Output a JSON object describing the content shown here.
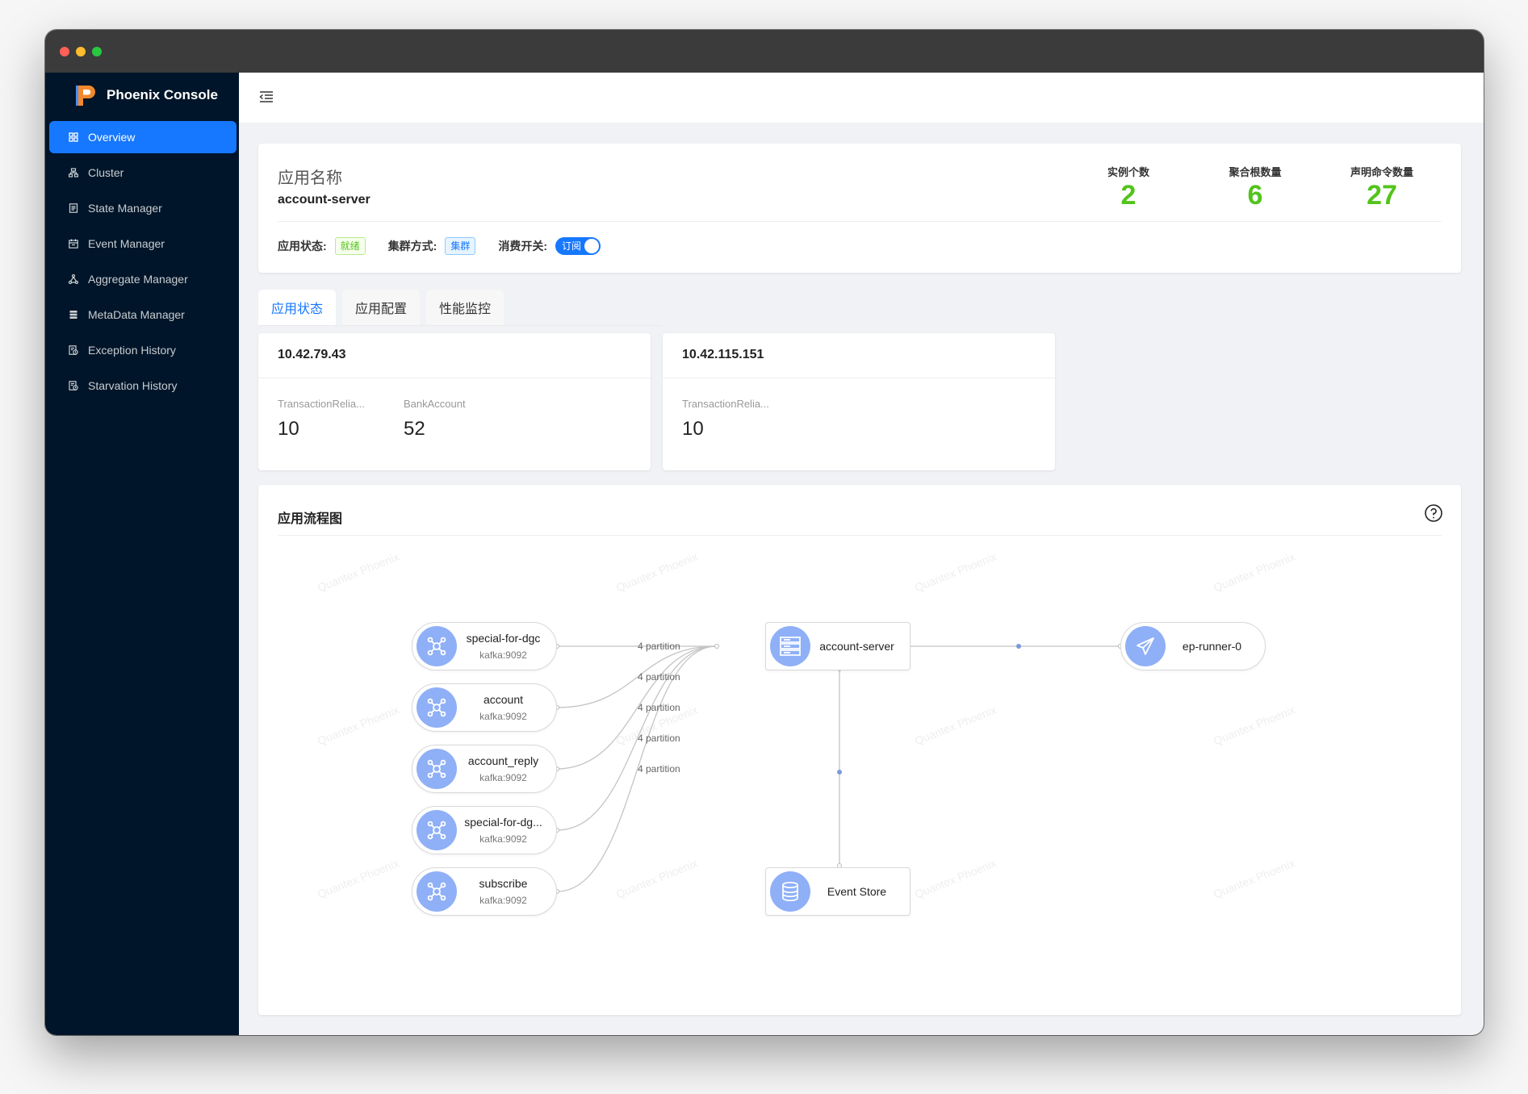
{
  "brand": {
    "name": "Phoenix Console"
  },
  "sidebar": {
    "items": [
      {
        "label": "Overview",
        "icon": "grid-icon"
      },
      {
        "label": "Cluster",
        "icon": "cluster-icon"
      },
      {
        "label": "State Manager",
        "icon": "document-icon"
      },
      {
        "label": "Event Manager",
        "icon": "calendar-icon"
      },
      {
        "label": "Aggregate Manager",
        "icon": "tree-icon"
      },
      {
        "label": "MetaData Manager",
        "icon": "database-icon"
      },
      {
        "label": "Exception History",
        "icon": "history-icon"
      },
      {
        "label": "Starvation History",
        "icon": "history-icon"
      }
    ],
    "active": "Overview"
  },
  "app": {
    "label": "应用名称",
    "name": "account-server",
    "stats": [
      {
        "title": "实例个数",
        "value": "2"
      },
      {
        "title": "聚合根数量",
        "value": "6"
      },
      {
        "title": "声明命令数量",
        "value": "27"
      }
    ],
    "status_label": "应用状态:",
    "status_value": "就绪",
    "cluster_label": "集群方式:",
    "cluster_value": "集群",
    "consume_label": "消费开关:",
    "consume_value": "订阅"
  },
  "tabs": [
    "应用状态",
    "应用配置",
    "性能监控"
  ],
  "instances": [
    {
      "ip": "10.42.79.43",
      "metrics": [
        {
          "name": "TransactionRelia...",
          "value": "10"
        },
        {
          "name": "BankAccount",
          "value": "52"
        }
      ]
    },
    {
      "ip": "10.42.115.151",
      "metrics": [
        {
          "name": "TransactionRelia...",
          "value": "10"
        }
      ]
    }
  ],
  "flow": {
    "title": "应用流程图",
    "watermark": "Quantex Phoenix",
    "sources": [
      {
        "name": "special-for-dgc",
        "sub": "kafka:9092"
      },
      {
        "name": "account",
        "sub": "kafka:9092"
      },
      {
        "name": "account_reply",
        "sub": "kafka:9092"
      },
      {
        "name": "special-for-dg...",
        "sub": "kafka:9092"
      },
      {
        "name": "subscribe",
        "sub": "kafka:9092"
      }
    ],
    "edge_labels": [
      "4 partition",
      "4 partition",
      "4 partition",
      "4 partition",
      "4 partition"
    ],
    "center": {
      "name": "account-server"
    },
    "target": {
      "name": "ep-runner-0"
    },
    "store": {
      "name": "Event Store"
    }
  },
  "colors": {
    "sidebar_bg": "#001529",
    "accent": "#1677ff",
    "stat_green": "#52c41a",
    "node_icon": "#8fb0f7"
  }
}
